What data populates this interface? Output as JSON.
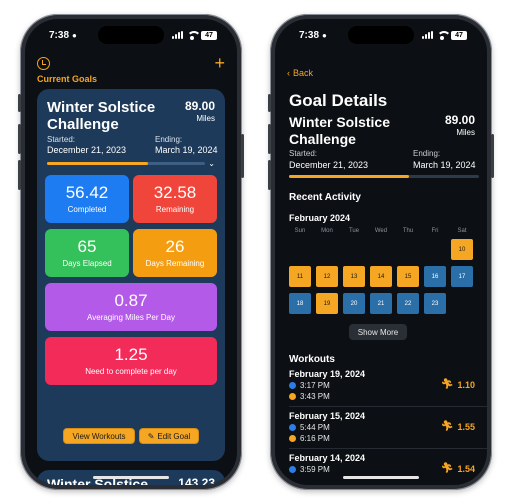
{
  "left_phone": {
    "status": {
      "time": "7:38",
      "battery": "47"
    },
    "header": {
      "section_title": "Current Goals"
    },
    "goal_card": {
      "title": "Winter Solstice Challenge",
      "miles_value": "89.00",
      "miles_unit": "Miles",
      "started_label": "Started:",
      "started_value": "December 21, 2023",
      "ending_label": "Ending:",
      "ending_value": "March 19, 2024",
      "progress_fraction": 0.64,
      "tiles": [
        {
          "value": "56.42",
          "label": "Completed"
        },
        {
          "value": "32.58",
          "label": "Remaining"
        },
        {
          "value": "65",
          "label": "Days Elapsed"
        },
        {
          "value": "26",
          "label": "Days Remaining"
        },
        {
          "value": "0.87",
          "label": "Averaging Miles Per Day"
        },
        {
          "value": "1.25",
          "label": "Need to complete per day"
        }
      ],
      "buttons": {
        "view_workouts": "View Workouts",
        "edit_goal": "Edit Goal"
      }
    },
    "next_card": {
      "title": "Winter Solstice",
      "miles": "143.23"
    }
  },
  "right_phone": {
    "status": {
      "time": "7:38",
      "battery": "47"
    },
    "back_label": "Back",
    "page_title": "Goal Details",
    "goal": {
      "title": "Winter Solstice Challenge",
      "miles_value": "89.00",
      "miles_unit": "Miles",
      "started_label": "Started:",
      "started_value": "December 21, 2023",
      "ending_label": "Ending:",
      "ending_value": "March 19, 2024",
      "progress_fraction": 0.63
    },
    "recent_activity": {
      "title": "Recent Activity",
      "month": "February 2024",
      "weekdays": [
        "Sun",
        "Mon",
        "Tue",
        "Wed",
        "Thu",
        "Fri",
        "Sat"
      ],
      "days": [
        {
          "d": "10",
          "status": "active"
        },
        {
          "d": "11",
          "status": "active"
        },
        {
          "d": "12",
          "status": "active"
        },
        {
          "d": "13",
          "status": "active"
        },
        {
          "d": "14",
          "status": "active"
        },
        {
          "d": "15",
          "status": "active"
        },
        {
          "d": "16",
          "status": "inactive"
        },
        {
          "d": "17",
          "status": "inactive"
        },
        {
          "d": "18",
          "status": "inactive"
        },
        {
          "d": "19",
          "status": "active"
        },
        {
          "d": "20",
          "status": "inactive"
        },
        {
          "d": "21",
          "status": "inactive"
        },
        {
          "d": "22",
          "status": "inactive"
        },
        {
          "d": "23",
          "status": "inactive"
        }
      ],
      "show_more": "Show More"
    },
    "workouts": {
      "title": "Workouts",
      "items": [
        {
          "date": "February 19, 2024",
          "start": "3:17 PM",
          "end": "3:43 PM",
          "miles": "1.10"
        },
        {
          "date": "February 15, 2024",
          "start": "5:44 PM",
          "end": "6:16 PM",
          "miles": "1.55"
        },
        {
          "date": "February 14, 2024",
          "start": "3:59 PM",
          "end": "",
          "miles": "1.54"
        }
      ]
    }
  }
}
